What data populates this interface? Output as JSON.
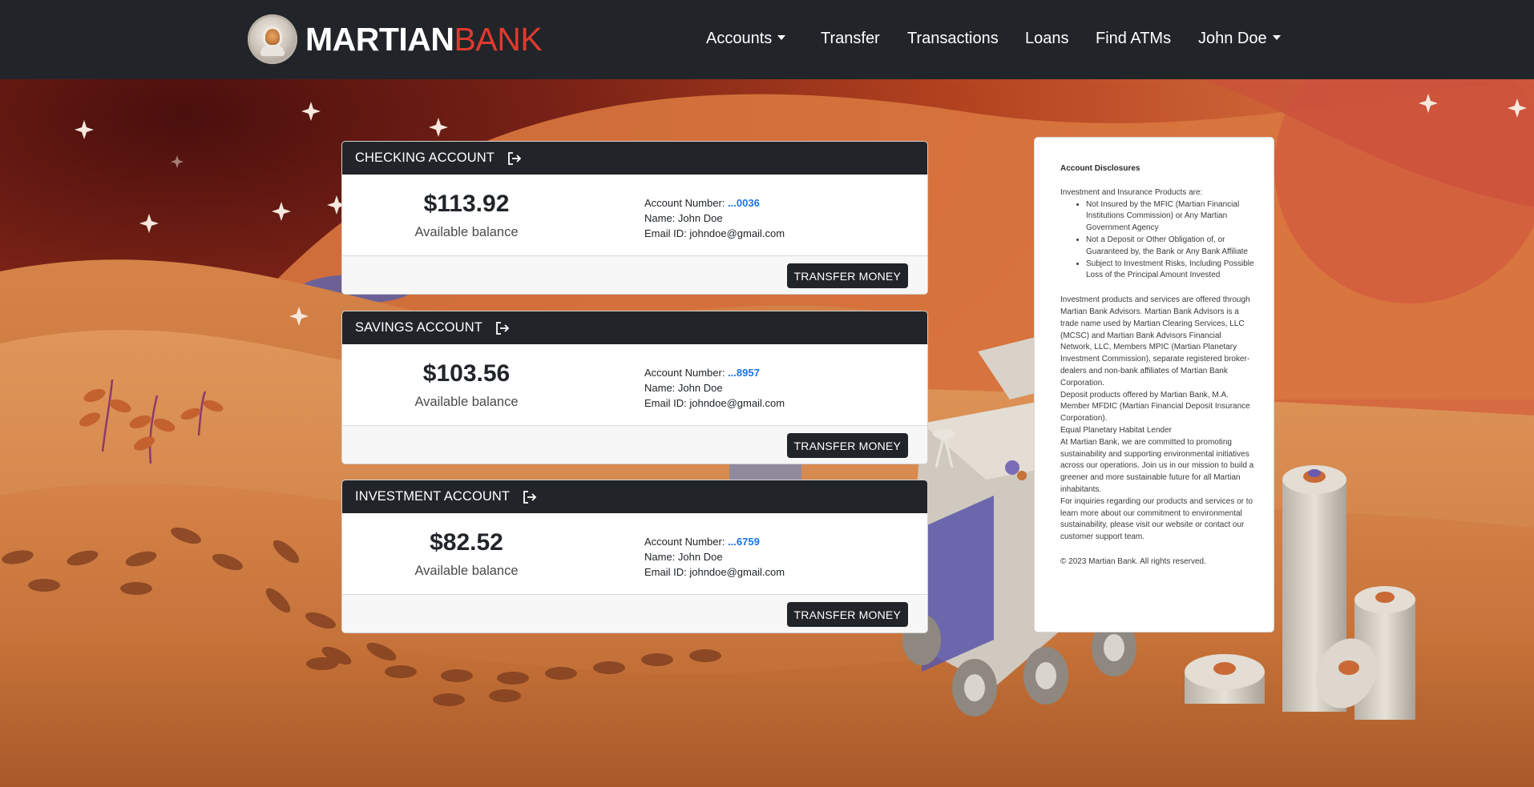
{
  "brand": {
    "name_bold": "MARTIAN",
    "name_light": "BANK"
  },
  "nav": {
    "accounts": "Accounts",
    "transfer": "Transfer",
    "transactions": "Transactions",
    "loans": "Loans",
    "find_atms": "Find ATMs",
    "user": "John Doe"
  },
  "accounts": [
    {
      "title": "CHECKING ACCOUNT",
      "balance": "$113.92",
      "balance_label": "Available balance",
      "number_label": "Account Number:",
      "number": "...0036",
      "name": "Name: John Doe",
      "email": "Email ID: johndoe@gmail.com",
      "button": "TRANSFER MONEY"
    },
    {
      "title": "SAVINGS ACCOUNT",
      "balance": "$103.56",
      "balance_label": "Available balance",
      "number_label": "Account Number:",
      "number": "...8957",
      "name": "Name: John Doe",
      "email": "Email ID: johndoe@gmail.com",
      "button": "TRANSFER MONEY"
    },
    {
      "title": "INVESTMENT ACCOUNT",
      "balance": "$82.52",
      "balance_label": "Available balance",
      "number_label": "Account Number:",
      "number": "...6759",
      "name": "Name: John Doe",
      "email": "Email ID: johndoe@gmail.com",
      "button": "TRANSFER MONEY"
    }
  ],
  "disclosure": {
    "heading": "Account Disclosures",
    "intro": "Investment and Insurance Products are:",
    "bullets": [
      "Not Insured by the MFIC (Martian Financial Institutions Commission) or Any Martian Government Agency",
      "Not a Deposit or Other Obligation of, or Guaranteed by, the Bank or Any Bank Affiliate",
      "Subject to Investment Risks, Including Possible Loss of the Principal Amount Invested"
    ],
    "p1": "Investment products and services are offered through Martian Bank Advisors. Martian Bank Advisors is a trade name used by Martian Clearing Services, LLC (MCSC) and Martian Bank Advisors Financial Network, LLC, Members MPIC (Martian Planetary Investment Commission), separate registered broker-dealers and non-bank affiliates of Martian Bank Corporation.",
    "p2": "Deposit products offered by Martian Bank, M.A. Member MFDIC (Martian Financial Deposit Insurance Corporation).",
    "p3": "Equal Planetary Habitat Lender",
    "p4": "At Martian Bank, we are committed to promoting sustainability and supporting environmental initiatives across our operations. Join us in our mission to build a greener and more sustainable future for all Martian inhabitants.",
    "p5": "For inquiries regarding our products and services or to learn more about our commitment to environmental sustainability, please visit our website or contact our customer support team.",
    "copyright": "© 2023 Martian Bank. All rights reserved."
  },
  "colors": {
    "navbar": "#212529",
    "brand_accent": "#e03a2f",
    "account_number": "#1a73e8",
    "sky_dark": "#5a1612",
    "sand": "#c9743e"
  }
}
